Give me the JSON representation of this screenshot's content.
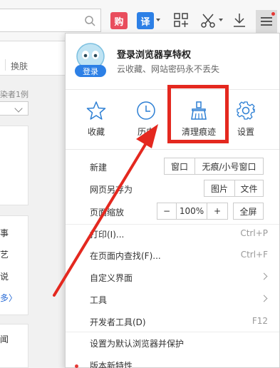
{
  "toolbar": {
    "gou_label": "购",
    "yi_label": "译",
    "icons": [
      "search-icon",
      "apps-icon",
      "scissors-icon",
      "download-icon",
      "menu-icon"
    ]
  },
  "background": {
    "huanfu": "换肤",
    "author": "染者1例",
    "items": [
      "事",
      "艺",
      "说",
      "多〉"
    ],
    "bottom": "闻"
  },
  "menu": {
    "login_title": "登录浏览器享特权",
    "login_sub": "云收藏、网站密码永不丢失",
    "login_badge": "登录",
    "quick": [
      {
        "label": "收藏",
        "icon": "star-icon"
      },
      {
        "label": "历史",
        "icon": "clock-icon"
      },
      {
        "label": "清理痕迹",
        "icon": "broom-icon"
      },
      {
        "label": "设置",
        "icon": "gear-icon"
      }
    ],
    "new_label": "新建",
    "new_window": "窗口",
    "new_incognito": "无痕/小号窗口",
    "save_as_label": "网页另存为",
    "save_image": "图片",
    "save_file": "文件",
    "zoom_label": "页面缩放",
    "zoom_minus": "−",
    "zoom_value": "100%",
    "zoom_plus": "+",
    "fullscreen": "全屏",
    "print_label": "打印(I)...",
    "print_shortcut": "Ctrl+P",
    "find_label": "在页面内查找(F)...",
    "find_shortcut": "Ctrl+F",
    "customize_label": "自定义界面",
    "tools_label": "工具",
    "devtools_label": "开发者工具(D)",
    "devtools_shortcut": "F12",
    "default_label": "设置为默认浏览器并保护",
    "new_features_label": "版本新特性"
  },
  "colors": {
    "highlight": "#e4281f",
    "accent_blue": "#2d80e6",
    "gou_red": "#e94d5d",
    "icon_blue": "#2d7fd4"
  }
}
